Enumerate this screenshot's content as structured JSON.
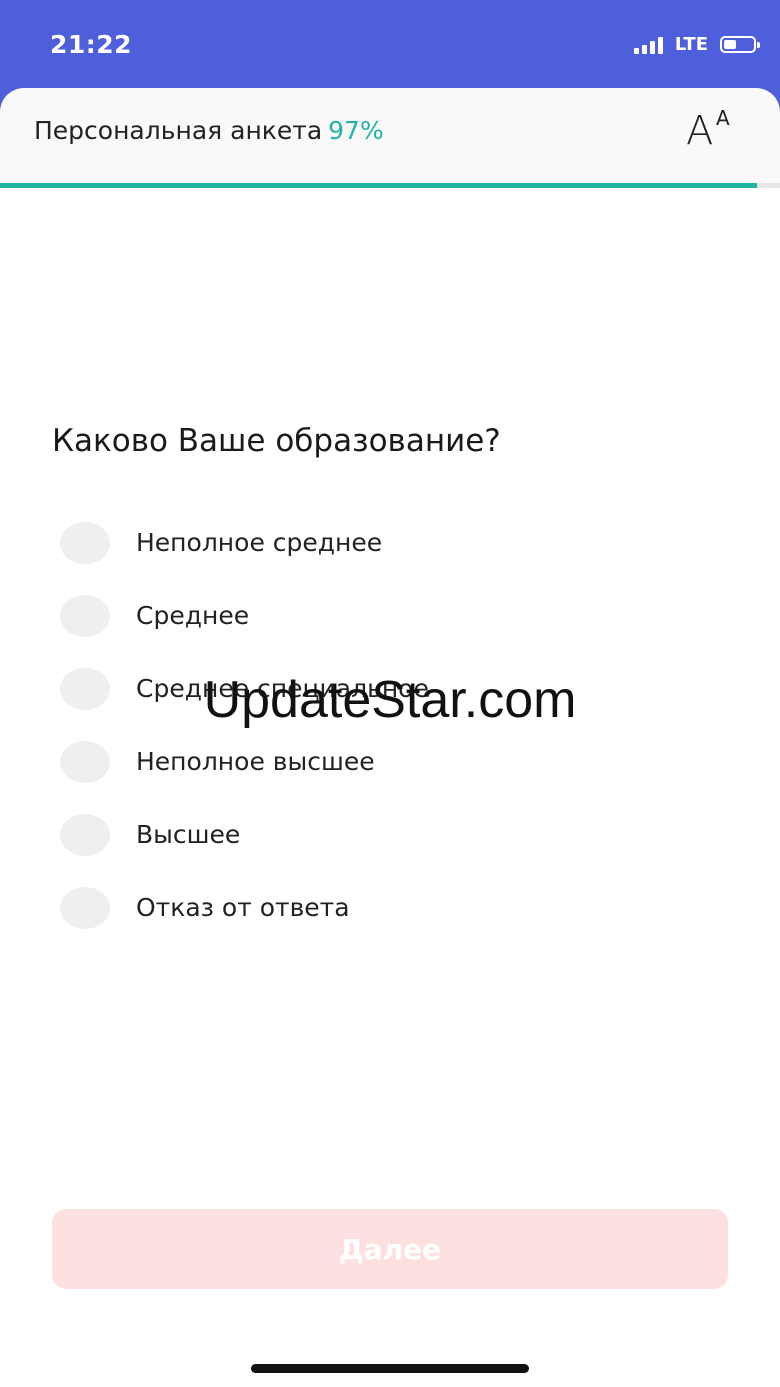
{
  "status_bar": {
    "time": "21:22",
    "network": "LTE",
    "signal_bars": 4,
    "battery_level": 0.5
  },
  "header": {
    "title": "Персональная анкета",
    "progress_text": "97%",
    "progress_value": 0.97,
    "font_size_icon": "font-size-icon"
  },
  "question": {
    "text": "Каково Ваше образование?",
    "options": [
      {
        "label": "Неполное среднее"
      },
      {
        "label": "Среднее"
      },
      {
        "label": "Среднее специальное"
      },
      {
        "label": "Неполное высшее"
      },
      {
        "label": "Высшее"
      },
      {
        "label": "Отказ от ответа"
      }
    ]
  },
  "watermark": "UpdateStar.com",
  "next_button": {
    "label": "Далее",
    "enabled": false
  },
  "colors": {
    "status_bar_bg": "#4d5fdb",
    "accent": "#23b3a4",
    "button_disabled_bg": "#fde0e0",
    "radio_bg": "#efefef"
  }
}
